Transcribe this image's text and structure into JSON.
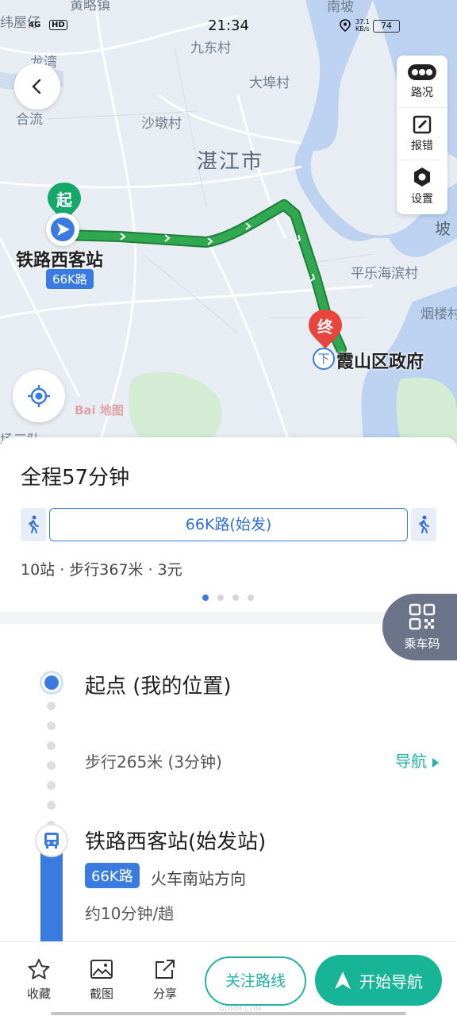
{
  "status_bar": {
    "time": "21:34",
    "network": "4G",
    "hd": "HD",
    "speed_value": "37.1",
    "speed_unit": "KB/s",
    "battery": "74"
  },
  "map": {
    "places": {
      "top_left_cut": "纬屋仔",
      "top_cut": "黄略镇",
      "top_right_cut": "南坡",
      "jiudong": "九东村",
      "longwan": "龙湾",
      "dabu": "大埠村",
      "heliu": "合流",
      "shadun": "沙墩村",
      "city": "湛江市",
      "right_edge": "坡",
      "pingle": "平乐海滨村",
      "yanlou": "烟楼村",
      "bottom_left": "场三队"
    },
    "start_marker": "起",
    "end_marker": "终",
    "start_station": "铁路西客站",
    "start_route_badge": "66K路",
    "end_station": "霞山区政府",
    "alight_icon": "下",
    "watermark": "Bai 地图"
  },
  "map_tools": [
    {
      "label": "路况",
      "icon": "traffic-icon"
    },
    {
      "label": "报错",
      "icon": "edit-icon"
    },
    {
      "label": "设置",
      "icon": "settings-icon"
    }
  ],
  "summary": {
    "title": "全程57分钟",
    "bus_segment": "66K路(始发)",
    "meta": "10站 · 步行367米 · 3元",
    "page_count": 4,
    "active_page": 1
  },
  "qr_button": {
    "label": "乘车码"
  },
  "detail": {
    "start_text": "起点 (我的位置)",
    "walk_text": "步行265米 (3分钟)",
    "nav_link": "导航",
    "station": "铁路西客站(始发站)",
    "line_badge": "66K路",
    "direction": "火车南站方向",
    "frequency": "约10分钟/趟"
  },
  "bottom_bar": {
    "favorite": "收藏",
    "screenshot": "截图",
    "share": "分享",
    "follow": "关注路线",
    "start_nav": "开始导航",
    "watermark_text": "GDMM.COM"
  },
  "colors": {
    "route": "#2fa84f",
    "accent_blue": "#3a7be0",
    "teal": "#17b497",
    "end_pin": "#e8453c"
  }
}
